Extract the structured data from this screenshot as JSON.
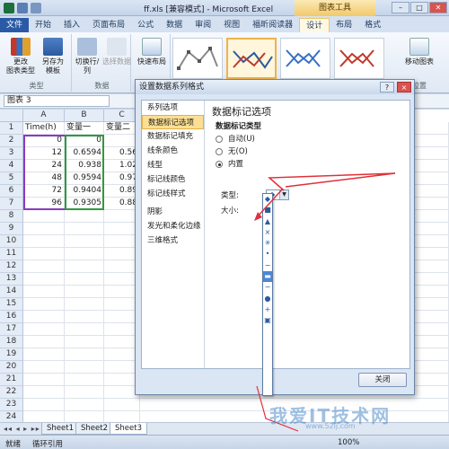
{
  "window": {
    "title": "ff.xls  [兼容模式] - Microsoft Excel",
    "tool_tab_group": "图表工具"
  },
  "ribbon": {
    "tabs": [
      "文件",
      "开始",
      "插入",
      "页面布局",
      "公式",
      "数据",
      "审阅",
      "视图",
      "福昕阅读器",
      "设计",
      "布局",
      "格式"
    ],
    "active_tab": "设计",
    "buttons": {
      "change_type": "更改\n图表类型",
      "save_template": "另存为\n模板",
      "switch_rowcol": "切换行/列",
      "select_data": "选择数据",
      "quick_layout": "快速布局",
      "move_chart": "移动图表"
    },
    "groups": {
      "type": "类型",
      "data": "数据",
      "location": "位置"
    }
  },
  "namebox": {
    "value": "图表 3"
  },
  "sheet": {
    "columns": [
      "A",
      "B",
      "C"
    ],
    "rows": [
      {
        "n": "1",
        "a": "Time(h)",
        "b": "变量一",
        "c": "变量二"
      },
      {
        "n": "2",
        "a": "0",
        "b": "0",
        "c": ""
      },
      {
        "n": "3",
        "a": "12",
        "b": "0.6594",
        "c": "0.56"
      },
      {
        "n": "4",
        "a": "24",
        "b": "0.938",
        "c": "1.02"
      },
      {
        "n": "5",
        "a": "48",
        "b": "0.9594",
        "c": "0.97"
      },
      {
        "n": "6",
        "a": "72",
        "b": "0.9404",
        "c": "0.89"
      },
      {
        "n": "7",
        "a": "96",
        "b": "0.9305",
        "c": "0.88"
      },
      {
        "n": "8"
      },
      {
        "n": "9"
      },
      {
        "n": "10"
      },
      {
        "n": "11"
      },
      {
        "n": "12"
      },
      {
        "n": "13"
      },
      {
        "n": "14"
      },
      {
        "n": "15"
      },
      {
        "n": "16"
      },
      {
        "n": "17"
      },
      {
        "n": "18"
      },
      {
        "n": "19"
      },
      {
        "n": "20"
      },
      {
        "n": "21"
      },
      {
        "n": "22"
      },
      {
        "n": "23"
      },
      {
        "n": "24"
      }
    ],
    "tabs": [
      "Sheet1",
      "Sheet2",
      "Sheet3"
    ],
    "active_tab": "Sheet3"
  },
  "status": {
    "ready": "就绪",
    "circular": "循环引用",
    "zoom": "100%"
  },
  "dialog": {
    "title": "设置数据系列格式",
    "help": "?",
    "close_x": "×",
    "categories": [
      "系列选项",
      "数据标记选项",
      "数据标记填充",
      "线条颜色",
      "线型",
      "标记线颜色",
      "标记线样式",
      "阴影",
      "发光和柔化边缘",
      "三维格式"
    ],
    "selected_category": "数据标记选项",
    "panel_title": "数据标记选项",
    "section_title": "数据标记类型",
    "options": [
      {
        "label": "自动(U)",
        "checked": false
      },
      {
        "label": "无(O)",
        "checked": false
      },
      {
        "label": "内置",
        "checked": true
      }
    ],
    "type_label": "类型:",
    "size_label": "大小:",
    "combo_symbol": "◆",
    "marker_list": [
      "◆",
      "■",
      "▲",
      "×",
      "✳",
      "•",
      "−",
      "▬",
      "−",
      "●",
      "+",
      "▣"
    ],
    "selected_marker_index": 7,
    "close_button": "关闭"
  },
  "watermark": {
    "main": "我爱IT技术网",
    "sub": "www.52ij.com"
  },
  "colors": {
    "accent": "#2a5aa6",
    "selected": "#fcdf93",
    "arrow": "#e0303a"
  }
}
